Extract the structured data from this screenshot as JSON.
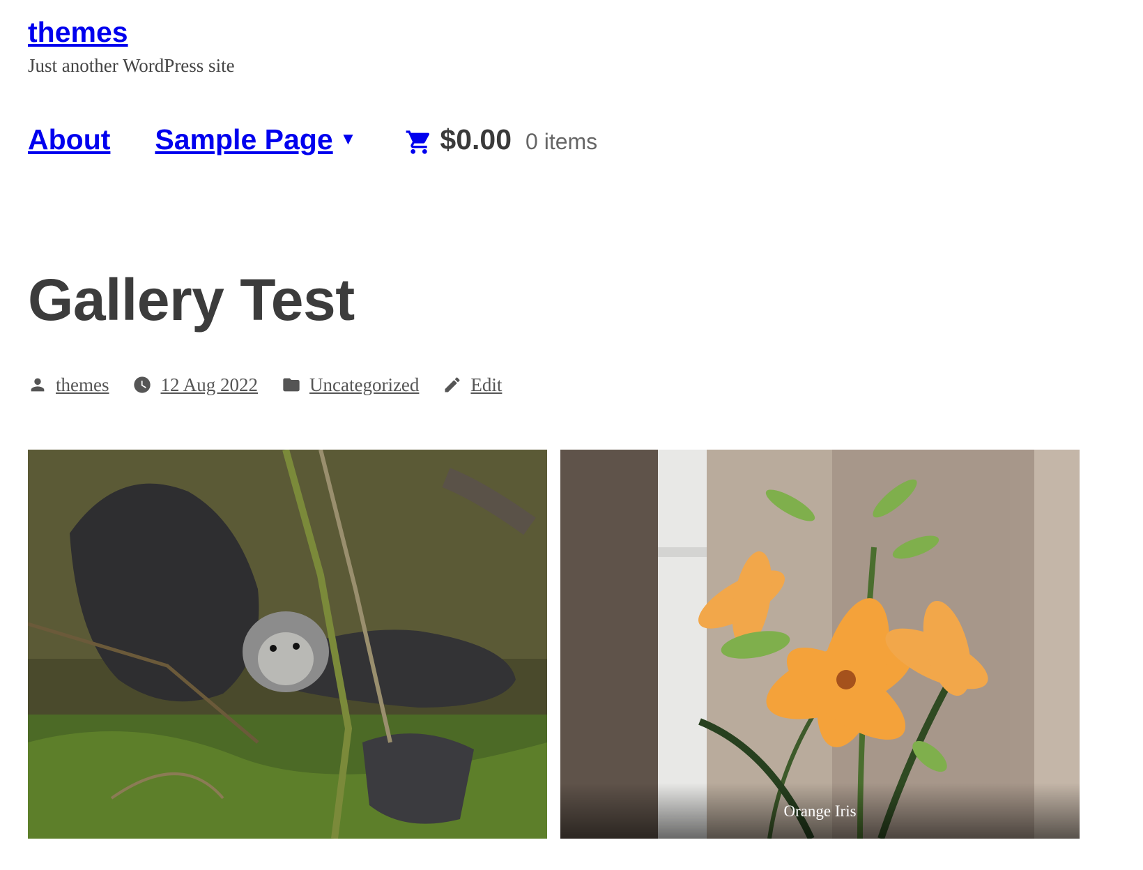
{
  "site": {
    "title": "themes",
    "tagline": "Just another WordPress site"
  },
  "nav": {
    "items": [
      {
        "label": "About",
        "icon": null
      },
      {
        "label": "Sample Page",
        "icon": "caret-down-icon"
      }
    ],
    "cart": {
      "icon": "cart-icon",
      "total": "$0.00",
      "count": "0 items"
    }
  },
  "post": {
    "title": "Gallery Test",
    "meta": {
      "author": "themes",
      "date": "12 Aug 2022",
      "category": "Uncategorized",
      "edit_label": "Edit"
    }
  },
  "gallery": {
    "images": [
      {
        "subject": "otters among mossy branches",
        "caption": ""
      },
      {
        "subject": "orange lilies beside white drainpipe",
        "caption": "Orange Iris"
      }
    ]
  },
  "colors": {
    "link": "#0000ee",
    "text": "#3c3c3c",
    "meta": "#555555"
  }
}
